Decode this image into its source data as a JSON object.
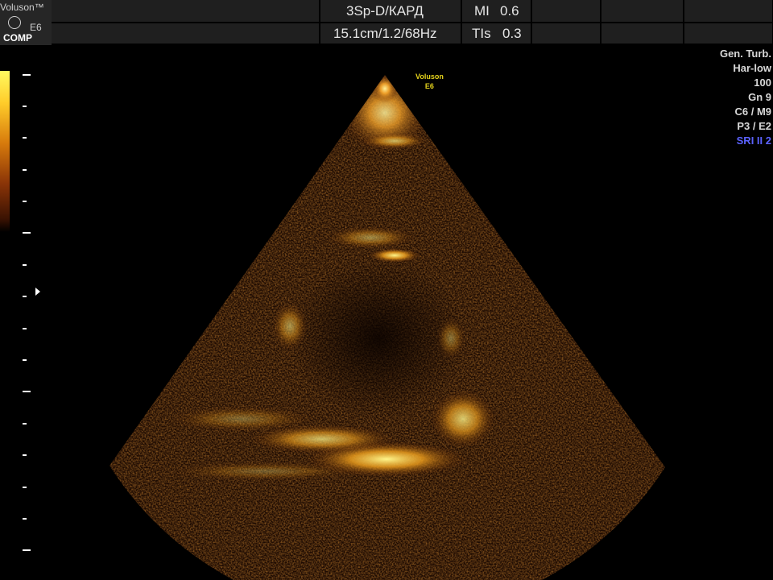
{
  "header": {
    "brand_name": "Voluson™",
    "model": "E6",
    "mode_badge": "COMP",
    "probe_preset": "3Sp-D/КАРД",
    "depth_info": "15.1cm/1.2/68Hz",
    "mi_label": "MI",
    "mi_value": "0.6",
    "tis_label": "TIs",
    "tis_value": "0.3"
  },
  "side_params": {
    "items": [
      "Gen. Turb.",
      "Har-low",
      "100",
      "Gn   9",
      "C6 / M9",
      "P3 / E2"
    ],
    "sri": "SRI II 2"
  },
  "image_label": {
    "line1": "Voluson",
    "line2": "E6"
  },
  "colors": {
    "accent_blue": "#5b62ff",
    "label_yellow": "#e5d31c",
    "header_cell": "#1f1f1f"
  },
  "icons": {
    "logo": "ge-logo-icon",
    "focus": "focus-marker-icon"
  }
}
